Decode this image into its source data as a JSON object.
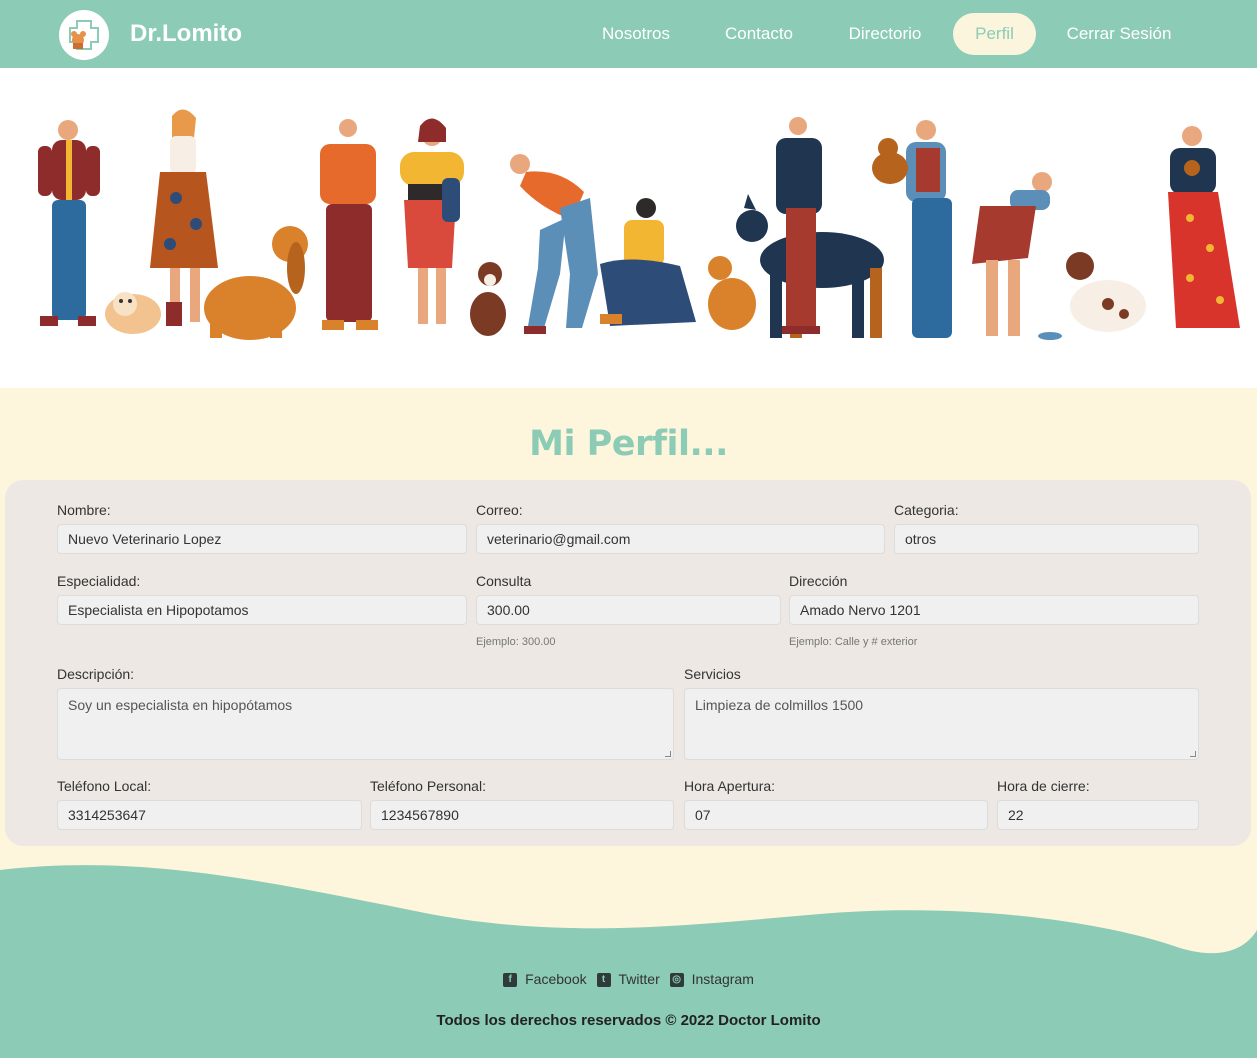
{
  "brand": {
    "name": "Dr.Lomito"
  },
  "nav": {
    "items": [
      {
        "label": "Nosotros",
        "active": false
      },
      {
        "label": "Contacto",
        "active": false
      },
      {
        "label": "Directorio",
        "active": false
      },
      {
        "label": "Perfil",
        "active": true
      },
      {
        "label": "Cerrar Sesión",
        "active": false
      }
    ]
  },
  "profile": {
    "title": "Mi Perfil...",
    "fields": {
      "nombre": {
        "label": "Nombre:",
        "value": "Nuevo Veterinario Lopez"
      },
      "correo": {
        "label": "Correo:",
        "value": "veterinario@gmail.com"
      },
      "categoria": {
        "label": "Categoria:",
        "value": "otros"
      },
      "especialidad": {
        "label": "Especialidad:",
        "value": "Especialista en Hipopotamos"
      },
      "consulta": {
        "label": "Consulta",
        "value": "300.00",
        "hint": "Ejemplo: 300.00"
      },
      "direccion": {
        "label": "Dirección",
        "value": "Amado Nervo 1201",
        "hint": "Ejemplo: Calle y # exterior"
      },
      "descripcion": {
        "label": "Descripción:",
        "value": "Soy un especialista en hipopótamos"
      },
      "servicios": {
        "label": "Servicios",
        "value": "Limpieza de colmillos 1500"
      },
      "telefono_local": {
        "label": "Teléfono Local:",
        "value": "3314253647"
      },
      "telefono_personal": {
        "label": "Teléfono Personal:",
        "value": "1234567890"
      },
      "hora_apertura": {
        "label": "Hora Apertura:",
        "value": "07"
      },
      "hora_cierre": {
        "label": "Hora de cierre:",
        "value": "22"
      }
    }
  },
  "footer": {
    "socials": [
      {
        "label": "Facebook",
        "icon": "facebook-icon"
      },
      {
        "label": "Twitter",
        "icon": "twitter-icon"
      },
      {
        "label": "Instagram",
        "icon": "instagram-icon"
      }
    ],
    "copyright": "Todos los derechos reservados © 2022 Doctor Lomito"
  },
  "colors": {
    "accent": "#8ccbb5",
    "cream": "#fdf6dc",
    "card": "#ede8e3"
  }
}
